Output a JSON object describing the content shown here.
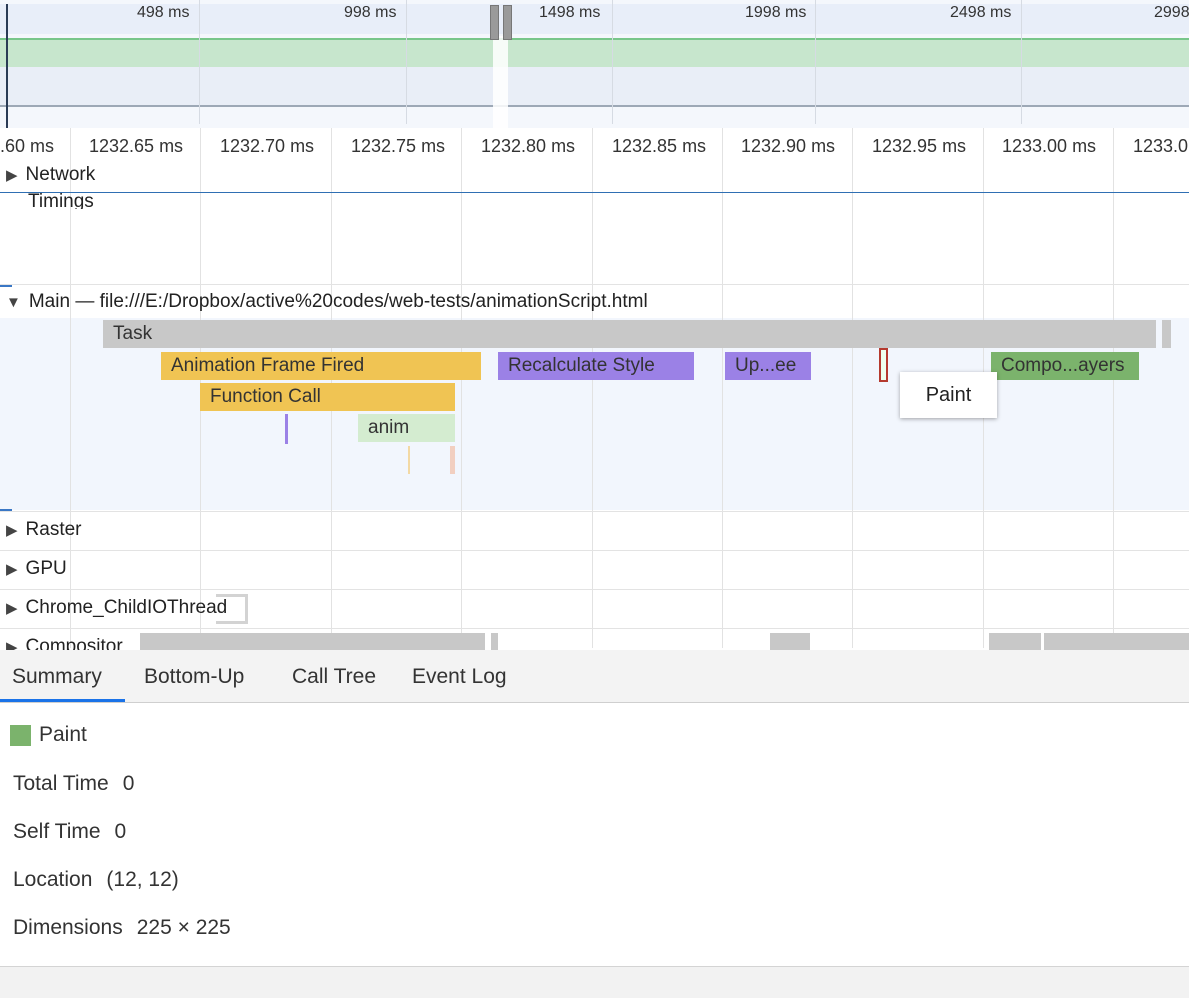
{
  "overview": {
    "ticks": [
      "498 ms",
      "998 ms",
      "1498 ms",
      "1998 ms",
      "2498 ms",
      "2998"
    ]
  },
  "ruler": {
    "ticks": [
      ".60 ms",
      "1232.65 ms",
      "1232.70 ms",
      "1232.75 ms",
      "1232.80 ms",
      "1232.85 ms",
      "1232.90 ms",
      "1232.95 ms",
      "1233.00 ms",
      "1233.0"
    ]
  },
  "tracks": {
    "network": "Network",
    "timings": "Timings",
    "main": "Main — file:///E:/Dropbox/active%20codes/web-tests/animationScript.html",
    "raster": "Raster",
    "gpu": "GPU",
    "childio": "Chrome_ChildIOThread",
    "compositor": "Compositor"
  },
  "events": {
    "task": "Task",
    "animation_frame": "Animation Frame Fired",
    "recalc_style": "Recalculate Style",
    "update_tree": "Up...ee",
    "composite": "Compo...ayers",
    "function_call": "Function Call",
    "anim": "anim"
  },
  "tooltip": {
    "text": "Paint"
  },
  "tabs": [
    "Summary",
    "Bottom-Up",
    "Call Tree",
    "Event Log"
  ],
  "summary": {
    "title": "Paint",
    "swatch_color": "#7bb36c",
    "total_time_label": "Total Time",
    "total_time_value": "0",
    "self_time_label": "Self Time",
    "self_time_value": "0",
    "location_label": "Location",
    "location_value": "(12, 12)",
    "dimensions_label": "Dimensions",
    "dimensions_value": "225 × 225"
  },
  "colors": {
    "scripting": "#f0c453",
    "rendering": "#9b81e6",
    "painting": "#7bb36c",
    "selection": "#b53a2f",
    "accent": "#1a73e8"
  }
}
